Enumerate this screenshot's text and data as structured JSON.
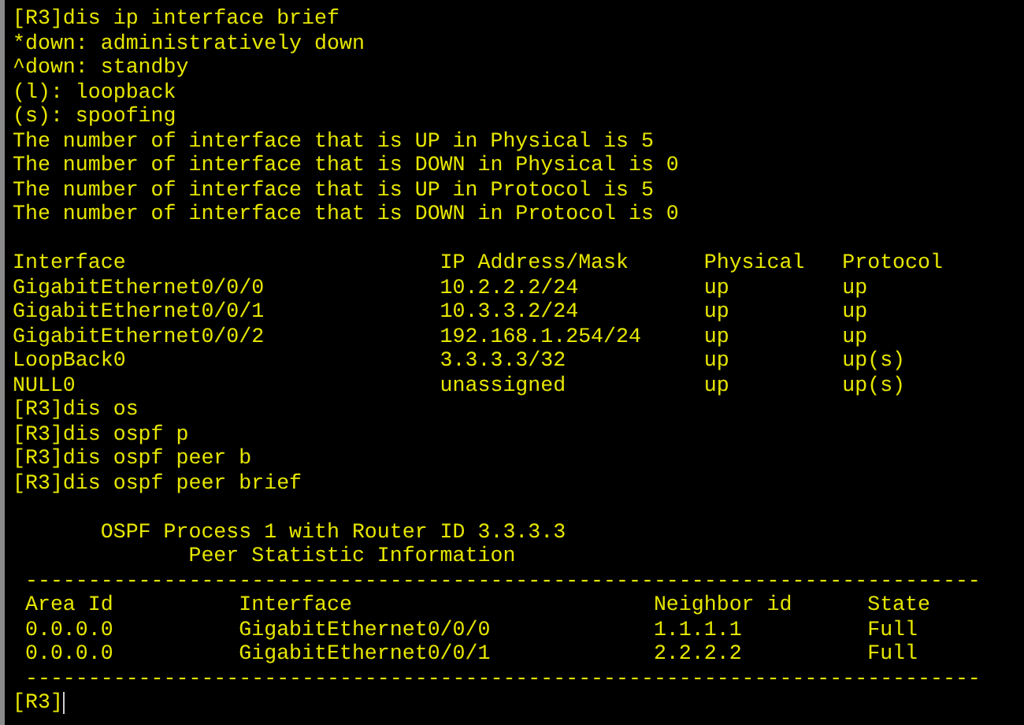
{
  "terminal": {
    "lines": [
      {
        "kind": "text",
        "text": "[R3]dis ip interface brief"
      },
      {
        "kind": "text",
        "text": "*down: administratively down"
      },
      {
        "kind": "text",
        "text": "^down: standby"
      },
      {
        "kind": "text",
        "text": "(l): loopback"
      },
      {
        "kind": "text",
        "text": "(s): spoofing"
      },
      {
        "kind": "text",
        "text": "The number of interface that is UP in Physical is 5"
      },
      {
        "kind": "text",
        "text": "The number of interface that is DOWN in Physical is 0"
      },
      {
        "kind": "text",
        "text": "The number of interface that is UP in Protocol is 5"
      },
      {
        "kind": "text",
        "text": "The number of interface that is DOWN in Protocol is 0"
      },
      {
        "kind": "blank"
      },
      {
        "kind": "text",
        "text": "Interface                         IP Address/Mask      Physical   Protocol"
      },
      {
        "kind": "text",
        "text": "GigabitEthernet0/0/0              10.2.2.2/24          up         up"
      },
      {
        "kind": "text",
        "text": "GigabitEthernet0/0/1              10.3.3.2/24          up         up"
      },
      {
        "kind": "text",
        "text": "GigabitEthernet0/0/2              192.168.1.254/24     up         up"
      },
      {
        "kind": "text",
        "text": "LoopBack0                         3.3.3.3/32           up         up(s)"
      },
      {
        "kind": "text",
        "text": "NULL0                             unassigned           up         up(s)"
      },
      {
        "kind": "text",
        "text": "[R3]dis os"
      },
      {
        "kind": "text",
        "text": "[R3]dis ospf p"
      },
      {
        "kind": "text",
        "text": "[R3]dis ospf peer b"
      },
      {
        "kind": "text",
        "text": "[R3]dis ospf peer brief"
      },
      {
        "kind": "blank"
      },
      {
        "kind": "text",
        "text": "       OSPF Process 1 with Router ID 3.3.3.3"
      },
      {
        "kind": "text",
        "text": "              Peer Statistic Information"
      },
      {
        "kind": "text",
        "text": " ----------------------------------------------------------------------------"
      },
      {
        "kind": "text",
        "text": " Area Id          Interface                        Neighbor id      State"
      },
      {
        "kind": "text",
        "text": " 0.0.0.0          GigabitEthernet0/0/0             1.1.1.1          Full"
      },
      {
        "kind": "text",
        "text": " 0.0.0.0          GigabitEthernet0/0/1             2.2.2.2          Full"
      },
      {
        "kind": "text",
        "text": " ----------------------------------------------------------------------------"
      },
      {
        "kind": "prompt",
        "text": "[R3]",
        "cursor": true
      }
    ]
  }
}
